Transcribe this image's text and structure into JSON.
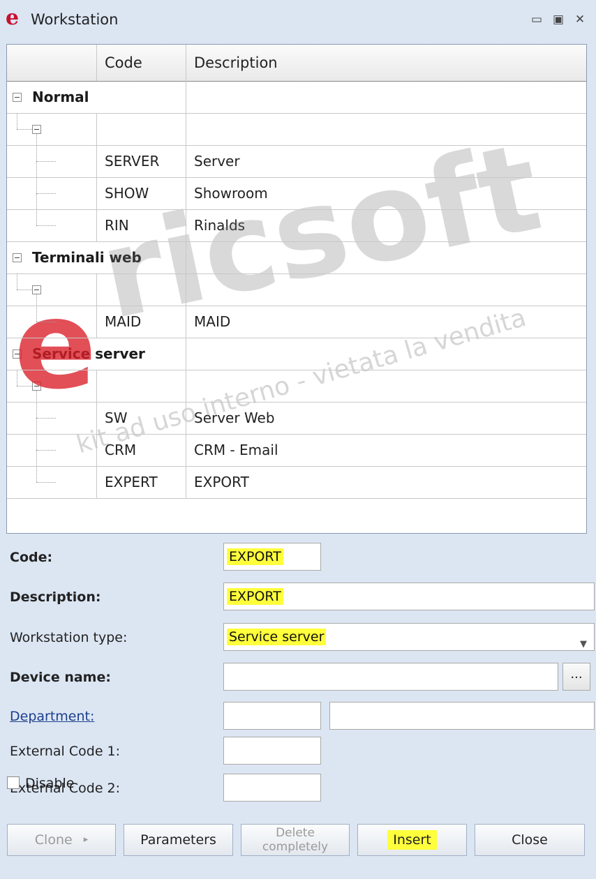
{
  "window": {
    "logo_letter": "e",
    "title": "Workstation",
    "controls": {
      "minimize": "▭",
      "maximize": "▣",
      "close": "✕"
    }
  },
  "grid": {
    "columns": [
      "Code",
      "Description"
    ],
    "groups": [
      {
        "name": "Normal",
        "rows": [
          {
            "code": "SERVER",
            "description": "Server"
          },
          {
            "code": "SHOW",
            "description": "Showroom"
          },
          {
            "code": "RIN",
            "description": "Rinalds"
          }
        ]
      },
      {
        "name": "Terminali web",
        "rows": [
          {
            "code": "MAID",
            "description": "MAID"
          }
        ]
      },
      {
        "name": "Service server",
        "rows": [
          {
            "code": "SW",
            "description": "Server Web"
          },
          {
            "code": "CRM",
            "description": "CRM - Email"
          },
          {
            "code": "EXPERT",
            "description": "EXPORT"
          }
        ]
      }
    ]
  },
  "watermark": {
    "brand_e": "e",
    "brand_rest": "ricsoft",
    "note": "kit ad uso interno - vietata la vendita"
  },
  "form": {
    "code_label": "Code:",
    "code_value": "EXPORT",
    "description_label": "Description:",
    "description_value": "EXPORT",
    "type_label": "Workstation type:",
    "type_value": "Service server",
    "device_label": "Device name:",
    "device_value": "",
    "browse_label": "...",
    "department_label": "Department:",
    "department_code": "",
    "department_name": "",
    "ext1_label": "External Code 1:",
    "ext1_value": "",
    "ext2_label": "External Code 2:",
    "ext2_value": "",
    "disable_label": "Disable"
  },
  "buttons": {
    "clone": "Clone",
    "clone_arrow": "▸",
    "parameters": "Parameters",
    "delete": "Delete completely",
    "insert": "Insert",
    "close": "Close"
  },
  "colors": {
    "highlight": "#ffff3b",
    "background": "#dce6f3",
    "logo_red": "#c8102e"
  }
}
